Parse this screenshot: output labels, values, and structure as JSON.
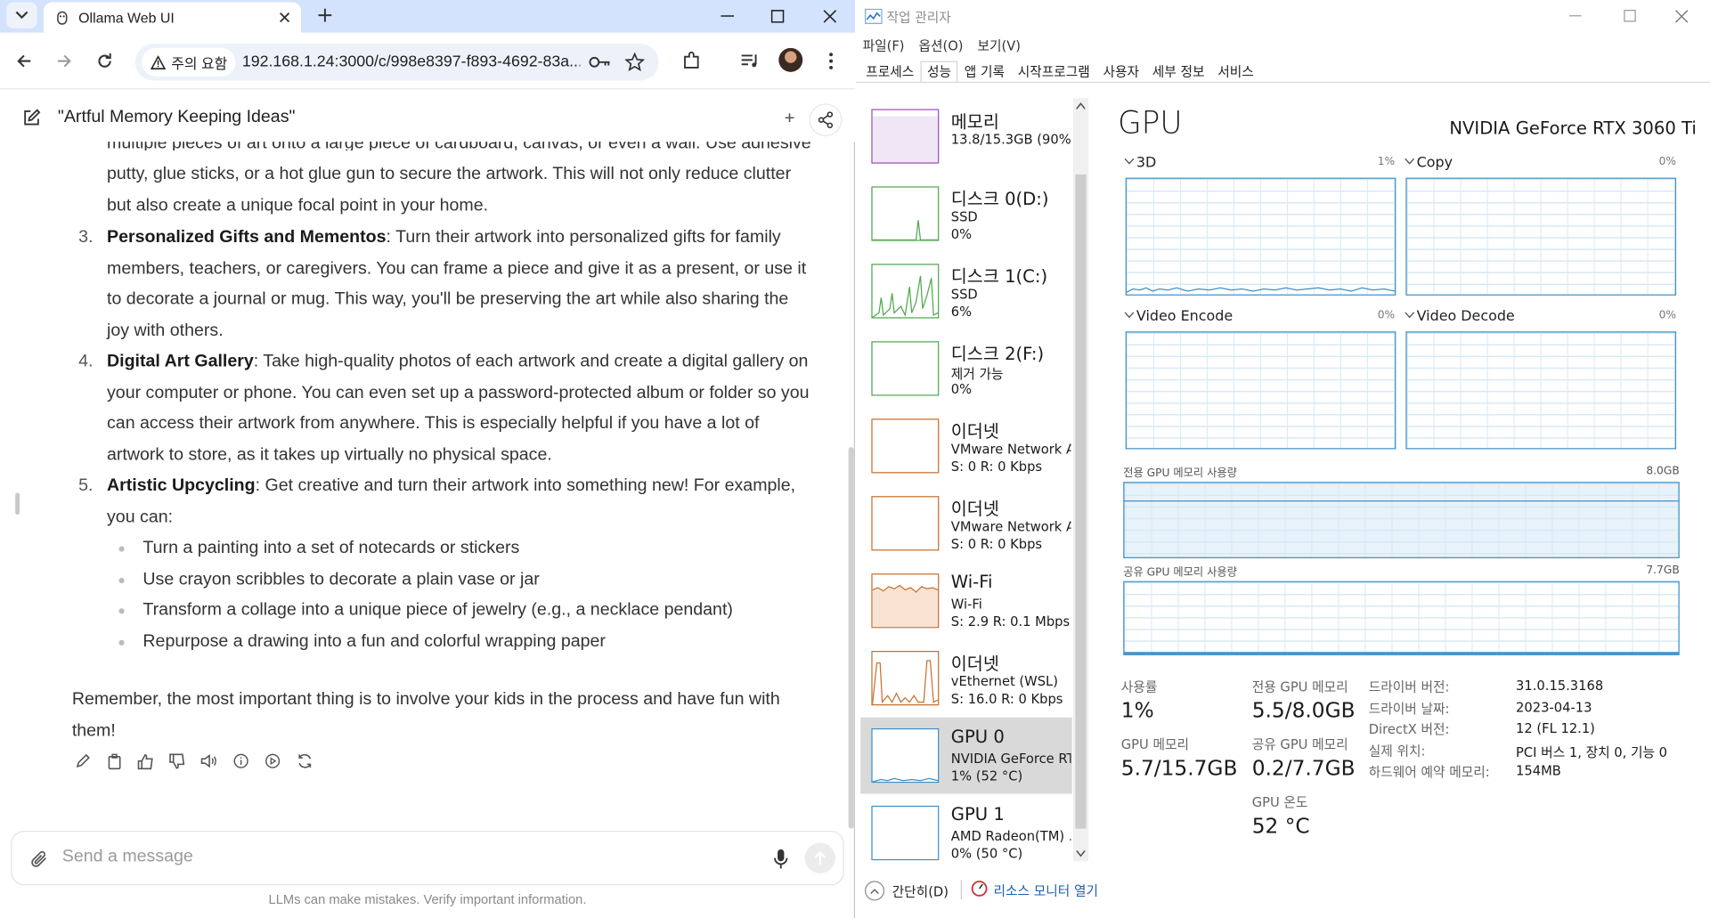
{
  "browser": {
    "tab_title": "Ollama Web UI",
    "security_label": "주의 요함",
    "url": "192.168.1.24:3000/c/998e8397-f893-4692-83a..."
  },
  "chat": {
    "title": "\"Artful Memory Keeping Ideas\"",
    "partial_top": "multiple pieces of art onto a large piece of cardboard, canvas, or even a wall. Use adhesive",
    "cont_lines": [
      "putty, glue sticks, or a hot glue gun to secure the artwork. This will not only reduce clutter",
      "but also create a unique focal point in your home."
    ],
    "items": [
      {
        "num": "3.",
        "title": "Personalized Gifts and Mementos",
        "lines": [
          ": Turn their artwork into personalized gifts for family",
          "members, teachers, or caregivers. You can frame a piece and give it as a present, or use it",
          "to decorate a journal or mug. This way, you'll be preserving the art while also sharing the",
          "joy with others."
        ]
      },
      {
        "num": "4.",
        "title": "Digital Art Gallery",
        "lines": [
          ": Take high-quality photos of each artwork and create a digital gallery on",
          "your computer or phone. You can even set up a password-protected album or folder so you",
          "can access their artwork from anywhere. This is especially helpful if you have a lot of",
          "artwork to store, as it takes up virtually no physical space."
        ]
      },
      {
        "num": "5.",
        "title": "Artistic Upcycling",
        "lines": [
          ": Get creative and turn their artwork into something new! For example,",
          "you can:"
        ]
      }
    ],
    "subitems": [
      "Turn a painting into a set of notecards or stickers",
      "Use crayon scribbles to decorate a plain vase or jar",
      "Transform a collage into a unique piece of jewelry (e.g., a necklace pendant)",
      "Repurpose a drawing into a fun and colorful wrapping paper"
    ],
    "closing": [
      "Remember, the most important thing is to involve your kids in the process and have fun with",
      "them!"
    ],
    "input_placeholder": "Send a message",
    "disclaimer": "LLMs can make mistakes. Verify important information."
  },
  "taskmgr": {
    "title": "작업 관리자",
    "menus": [
      "파일(F)",
      "옵션(O)",
      "보기(V)"
    ],
    "tabs": [
      "프로세스",
      "성능",
      "앱 기록",
      "시작프로그램",
      "사용자",
      "세부 정보",
      "서비스"
    ],
    "devices": [
      {
        "name": "메모리",
        "l2": "13.8/15.3GB (90%)",
        "l3": "",
        "color": "#9b4dba"
      },
      {
        "name": "디스크 0(D:)",
        "l2": "SSD",
        "l3": "0%",
        "color": "#4da84d"
      },
      {
        "name": "디스크 1(C:)",
        "l2": "SSD",
        "l3": "6%",
        "color": "#4da84d"
      },
      {
        "name": "디스크 2(F:)",
        "l2": "제거 가능",
        "l3": "0%",
        "color": "#4da84d"
      },
      {
        "name": "이더넷",
        "l2": "VMware Network A...",
        "l3": "S: 0 R: 0 Kbps",
        "color": "#c86f2c"
      },
      {
        "name": "이더넷",
        "l2": "VMware Network A...",
        "l3": "S: 0 R: 0 Kbps",
        "color": "#c86f2c"
      },
      {
        "name": "Wi-Fi",
        "l2": "Wi-Fi",
        "l3": "S: 2.9 R: 0.1 Mbps",
        "color": "#c86f2c"
      },
      {
        "name": "이더넷",
        "l2": "vEthernet (WSL)",
        "l3": "S: 16.0 R: 0 Kbps",
        "color": "#c86f2c"
      },
      {
        "name": "GPU 0",
        "l2": "NVIDIA GeForce RT...",
        "l3": "1% (52 °C)",
        "color": "#3c8fc9"
      },
      {
        "name": "GPU 1",
        "l2": "AMD Radeon(TM) ...",
        "l3": "0% (50 °C)",
        "color": "#3c8fc9"
      }
    ],
    "gpu": {
      "heading": "GPU",
      "model": "NVIDIA GeForce RTX 3060 Ti",
      "engines": [
        {
          "label": "3D",
          "pct": "1%"
        },
        {
          "label": "Copy",
          "pct": "0%"
        },
        {
          "label": "Video Encode",
          "pct": "0%"
        },
        {
          "label": "Video Decode",
          "pct": "0%"
        }
      ],
      "dedicated_label": "전용 GPU 메모리 사용량",
      "dedicated_max": "8.0GB",
      "shared_label": "공유 GPU 메모리 사용량",
      "shared_max": "7.7GB",
      "stats": [
        {
          "label": "사용률",
          "value": "1%"
        },
        {
          "label": "전용 GPU 메모리",
          "value": "5.5/8.0GB"
        },
        {
          "label": "GPU 메모리",
          "value": "5.7/15.7GB"
        },
        {
          "label": "공유 GPU 메모리",
          "value": "0.2/7.7GB"
        },
        {
          "label": "GPU 온도",
          "value": "52 °C"
        }
      ],
      "details": [
        {
          "k": "드라이버 버전:",
          "v": "31.0.15.3168"
        },
        {
          "k": "드라이버 날짜:",
          "v": "2023-04-13"
        },
        {
          "k": "DirectX 버전:",
          "v": "12 (FL 12.1)"
        },
        {
          "k": "실제 위치:",
          "v": "PCI 버스 1, 장치 0, 기능 0"
        },
        {
          "k": "하드웨어 예약 메모리:",
          "v": "154MB"
        }
      ]
    },
    "footer_less": "간단히(D)",
    "footer_resmon": "리소스 모니터 열기"
  }
}
